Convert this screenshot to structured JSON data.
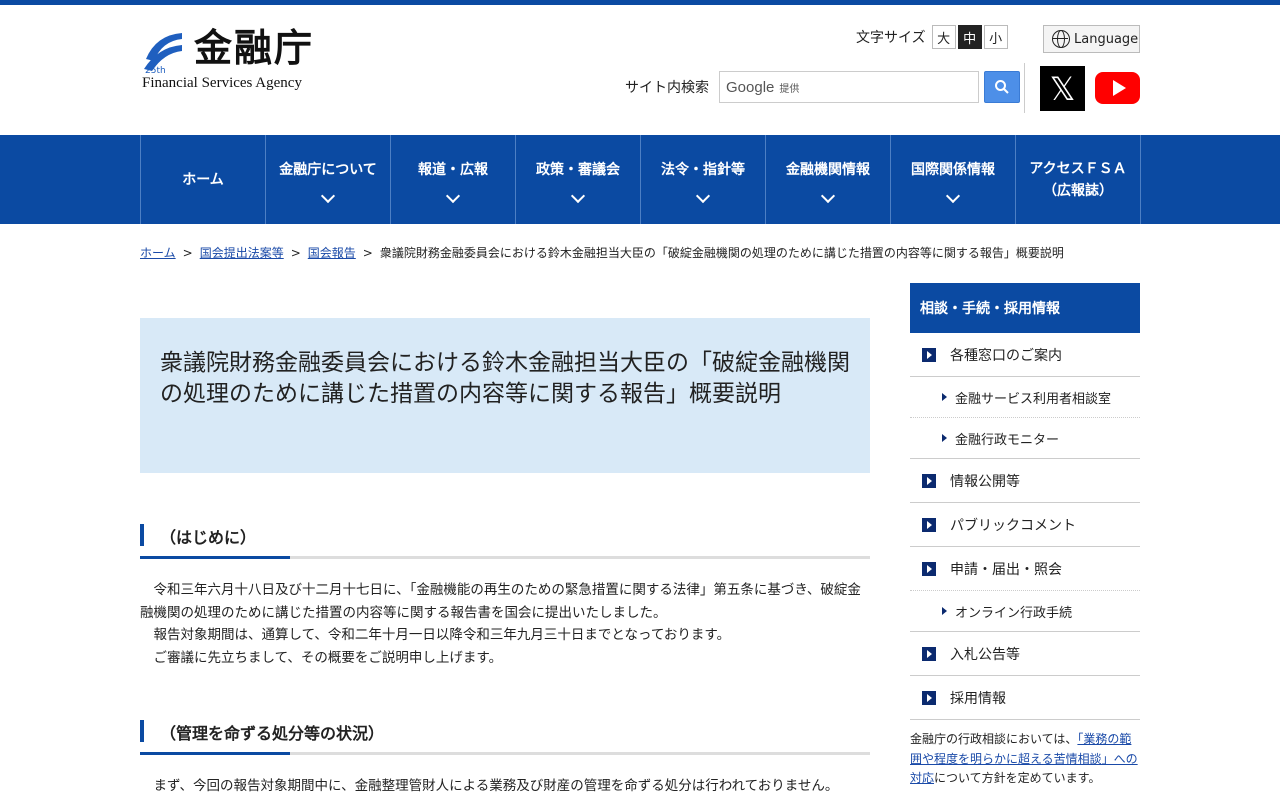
{
  "header": {
    "logo_jp": "金融庁",
    "logo_en": "Financial Services Agency",
    "font_size_label": "文字サイズ",
    "font_sizes": [
      "大",
      "中",
      "小"
    ],
    "font_size_selected": "中",
    "language_label": "Language",
    "search_label": "サイト内検索",
    "search_provider": "Google",
    "search_provider_suffix": "提供"
  },
  "nav": {
    "items": [
      {
        "label": "ホーム"
      },
      {
        "label": "金融庁について"
      },
      {
        "label": "報道・広報"
      },
      {
        "label": "政策・審議会"
      },
      {
        "label": "法令・指針等"
      },
      {
        "label": "金融機関情報"
      },
      {
        "label": "国際関係情報"
      },
      {
        "label": "アクセスＦＳＡ\n（広報誌）"
      }
    ]
  },
  "breadcrumb": {
    "links": [
      "ホーム",
      "国会提出法案等",
      "国会報告"
    ],
    "current": "衆議院財務金融委員会における鈴木金融担当大臣の「破綻金融機関の処理のために講じた措置の内容等に関する報告」概要説明",
    "separator": ">"
  },
  "main": {
    "title": "衆議院財務金融委員会における鈴木金融担当大臣の「破綻金融機関の処理のために講じた措置の内容等に関する報告」概要説明",
    "sections": [
      {
        "heading": "（はじめに）",
        "paragraphs": [
          "令和三年六月十八日及び十二月十七日に、「金融機能の再生のための緊急措置に関する法律」第五条に基づき、破綻金融機関の処理のために講じた措置の内容等に関する報告書を国会に提出いたしました。",
          "報告対象期間は、通算して、令和二年十月一日以降令和三年九月三十日までとなっております。",
          "ご審議に先立ちまして、その概要をご説明申し上げます。"
        ]
      },
      {
        "heading": "（管理を命ずる処分等の状況）",
        "paragraphs": [
          "まず、今回の報告対象期間中に、金融整理管財人による業務及び財産の管理を命ずる処分は行われておりません。"
        ]
      }
    ]
  },
  "sidebar": {
    "heading": "相談・手続・採用情報",
    "items": [
      {
        "label": "各種窓口のご案内",
        "sub": [
          "金融サービス利用者相談室",
          "金融行政モニター"
        ]
      },
      {
        "label": "情報公開等",
        "sub": []
      },
      {
        "label": "パブリックコメント",
        "sub": []
      },
      {
        "label": "申請・届出・照会",
        "sub": [
          "オンライン行政手続"
        ]
      },
      {
        "label": "入札公告等",
        "sub": []
      },
      {
        "label": "採用情報",
        "sub": []
      }
    ],
    "note_prefix": "金融庁の行政相談においては、",
    "note_link": "「業務の範囲や程度を明らかに超える苦情相談」への対応",
    "note_suffix": "について方針を定めています。"
  },
  "colors": {
    "brand": "#0b4aa2",
    "title_bg": "#d8e9f7",
    "youtube": "#ff0000"
  }
}
